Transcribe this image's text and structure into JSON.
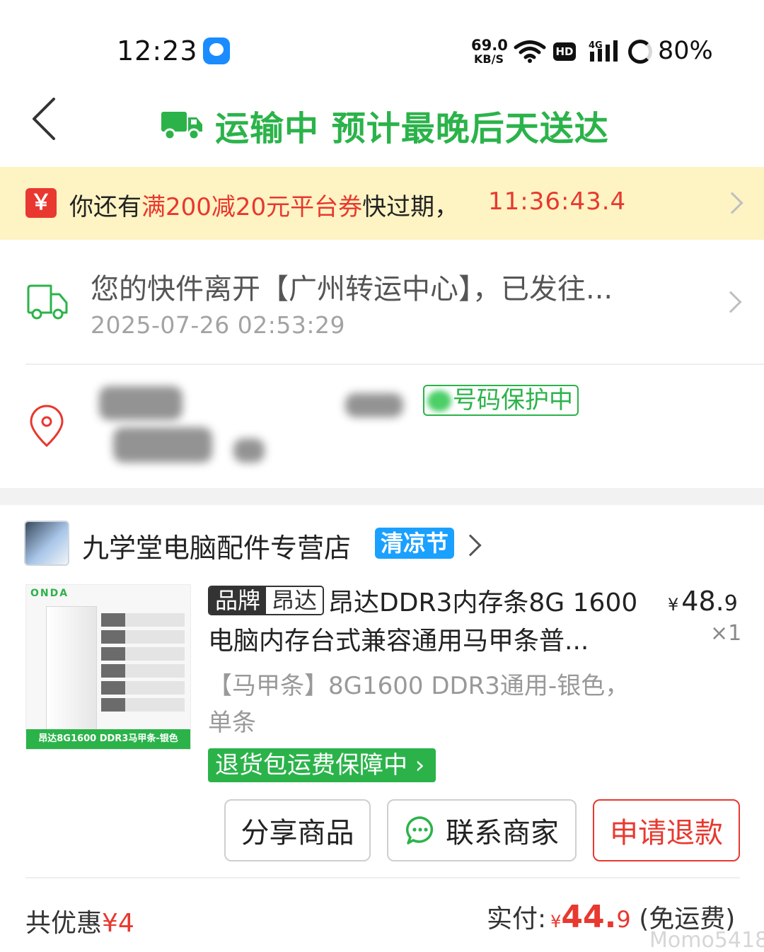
{
  "status_bar": {
    "time": "12:23",
    "net_speed_value": "69.0",
    "net_speed_unit": "KB/S",
    "hd_label": "HD",
    "network_type": "4G",
    "battery_pct": "80%"
  },
  "header": {
    "status_text": "运输中 预计最晚后天送达",
    "accent_color": "#2bb34a"
  },
  "coupon_banner": {
    "icon_glyph": "￥",
    "text_prefix": "你还有",
    "text_highlight": "满200减20元平台券",
    "text_suffix": "快过期，",
    "countdown": "11:36:43.4"
  },
  "logistics": {
    "message": "您的快件离开【广州转运中心】，已发往...",
    "timestamp": "2025-07-26 02:53:29"
  },
  "address": {
    "privacy_badge": "号码保护中"
  },
  "shop": {
    "name": "九学堂电脑配件专营店",
    "tag": "清凉节"
  },
  "product": {
    "image_brand": "ONDA",
    "image_caption": "昂达8G1600 DDR3马甲条-银色",
    "brand_chip_key": "品牌",
    "brand_chip_value": "昂达",
    "title": "昂达DDR3内存条8G 1600电脑内存台式兼容通用马甲条普...",
    "price_symbol": "¥",
    "price_int": "48.",
    "price_dec": "9",
    "quantity": "×1",
    "sku": "【马甲条】8G1600 DDR3通用-银色，单条",
    "guarantee": "退货包运费保障中"
  },
  "actions": {
    "share": "分享商品",
    "contact": "联系商家",
    "refund": "申请退款"
  },
  "footer": {
    "discount_label": "共优惠",
    "discount_value": "¥4",
    "paid_label": "实付:",
    "paid_symbol": "¥",
    "paid_int": "44.",
    "paid_dec": "9",
    "shipping_note": "(免运费)",
    "watermark": "Momo5418"
  },
  "colors": {
    "green": "#2bb34a",
    "red": "#e8382f",
    "banner_bg": "#fdf3c3",
    "shop_tag_blue": "#1aa0ff"
  }
}
